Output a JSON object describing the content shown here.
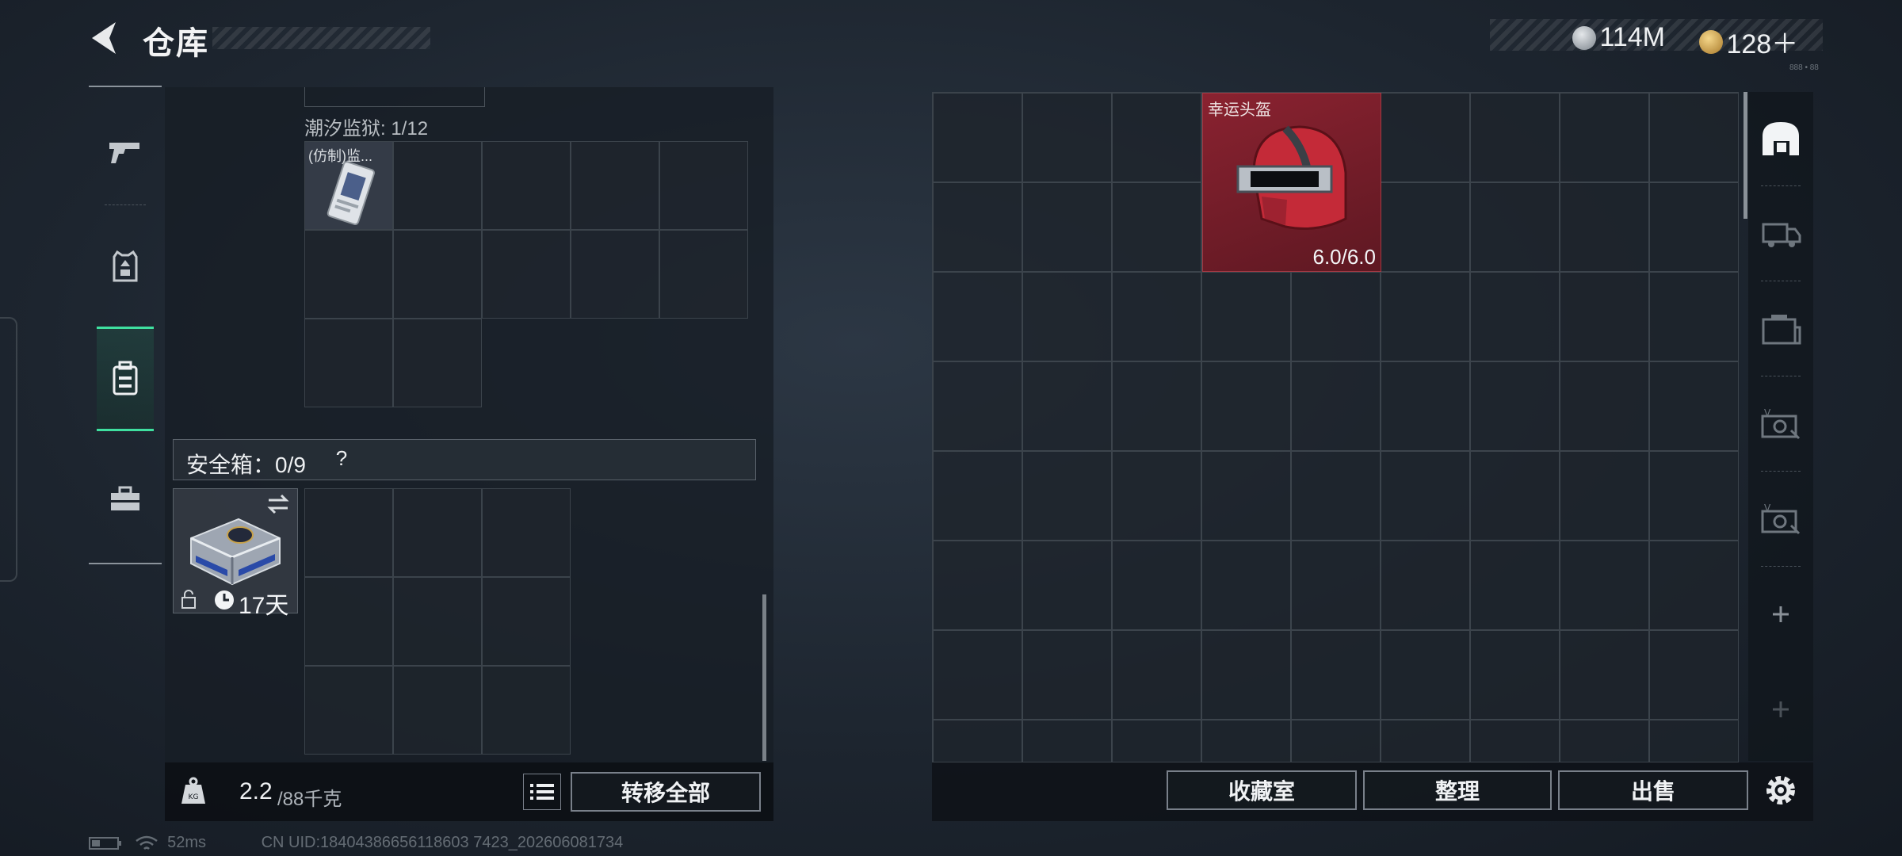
{
  "header": {
    "title": "仓库",
    "currency": [
      {
        "icon": "silver-coin-icon",
        "value": "114M"
      },
      {
        "icon": "gold-coin-icon",
        "value": "128＋"
      }
    ],
    "tiny_label": "888 • 88"
  },
  "left_rail": {
    "items": [
      {
        "icon": "gun-icon",
        "active": false
      },
      {
        "icon": "armor-vest-icon",
        "active": false
      },
      {
        "icon": "backpack-icon",
        "active": true
      },
      {
        "icon": "toolbox-icon",
        "active": false
      }
    ]
  },
  "container": {
    "label": "潮汐监狱: 1/12",
    "item_name": "(仿制)监..."
  },
  "safe_box": {
    "label": "安全箱：0/9",
    "help": "?",
    "duration": "17天"
  },
  "weight": {
    "current": "2.2",
    "max": "/88千克"
  },
  "buttons": {
    "transfer_all": "转移全部",
    "collection": "收藏室",
    "sort": "整理",
    "sell": "出售"
  },
  "stash_item": {
    "name": "幸运头盔",
    "durability": "6.0/6.0"
  },
  "right_rail": {
    "items": [
      "helmet-icon",
      "truck-icon",
      "crate-icon",
      "vehicle-case-icon",
      "vehicle-case-icon-2",
      "plus-icon",
      "plus-icon-disabled"
    ]
  },
  "status": {
    "ping": "52ms",
    "uid": "CN UID:18404386656118603 7423_202606081734"
  },
  "colors": {
    "accent_green": "#3fe0a0",
    "helmet_bg": "#7a1e2a",
    "panel": "#171d25"
  }
}
